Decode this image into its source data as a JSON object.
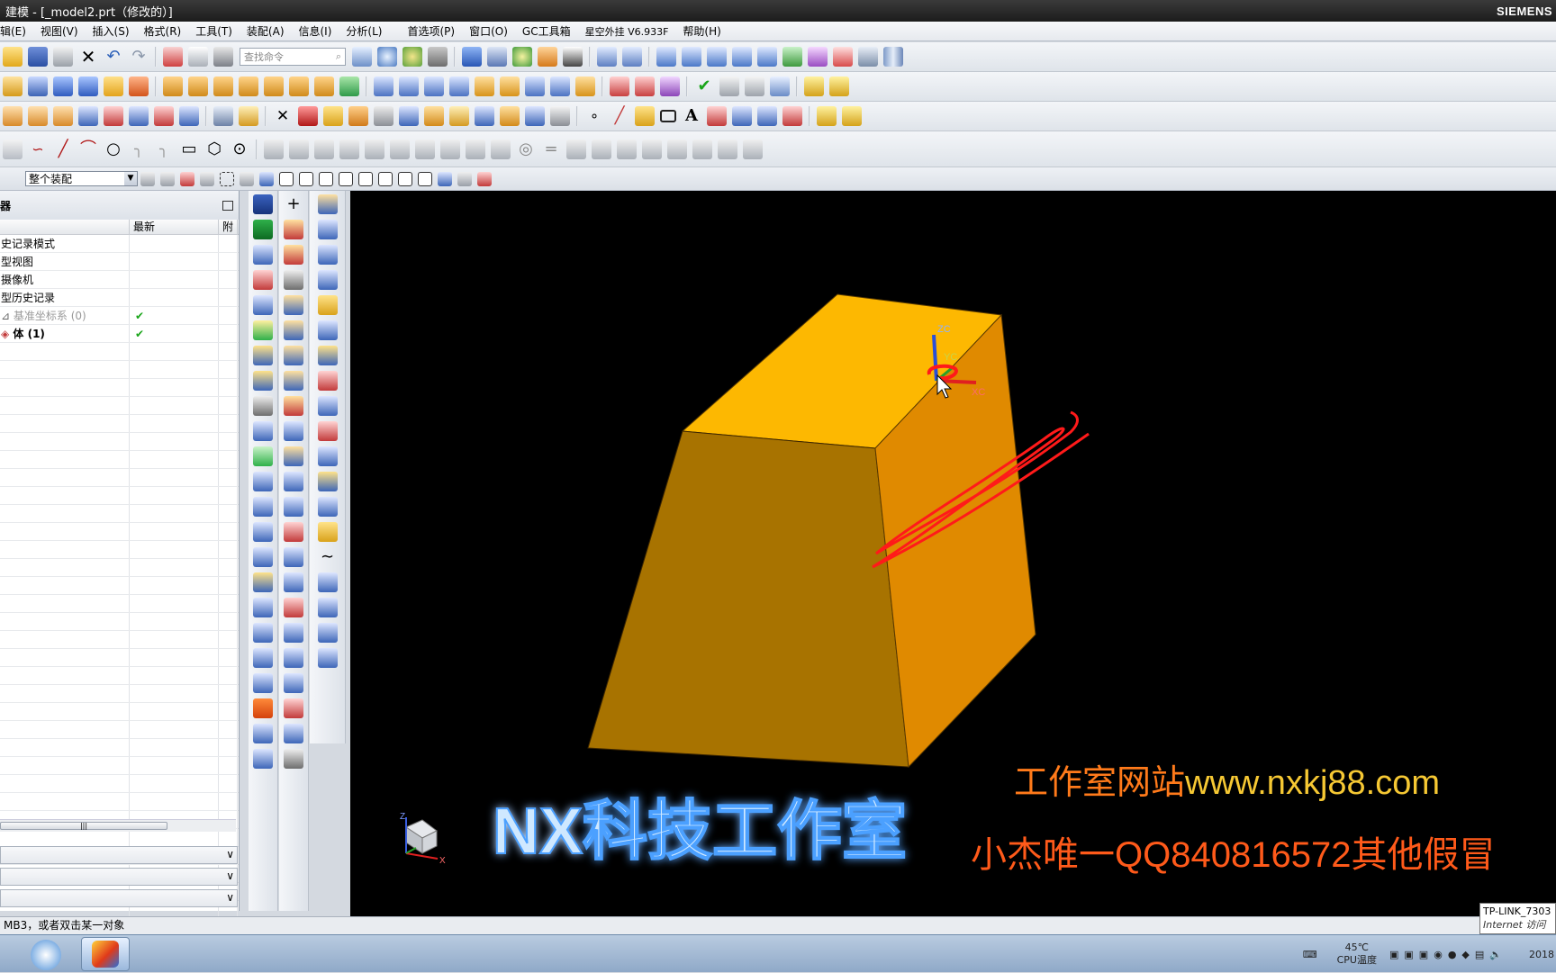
{
  "window": {
    "title": "建模 - [_model2.prt（修改的）]",
    "brand": "SIEMENS"
  },
  "menu": [
    "辑(E)",
    "视图(V)",
    "插入(S)",
    "格式(R)",
    "工具(T)",
    "装配(A)",
    "信息(I)",
    "分析(L)",
    "首选项(P)",
    "窗口(O)",
    "GC工具箱",
    "星空外挂 V6.933F",
    "帮助(H)"
  ],
  "toolbar": {
    "search_placeholder": "查找命令"
  },
  "selection": {
    "filter_value": "整个装配"
  },
  "navigator": {
    "title": "器",
    "columns": [
      "",
      "最新",
      "附"
    ],
    "rows": [
      {
        "label": "史记录模式",
        "latest": "",
        "dim": false
      },
      {
        "label": "型视图",
        "latest": "",
        "dim": false
      },
      {
        "label": "摄像机",
        "latest": "",
        "dim": false
      },
      {
        "label": "型历史记录",
        "latest": "",
        "dim": false
      },
      {
        "label": "基准坐标系 (0)",
        "latest": "✔",
        "dim": true
      },
      {
        "label": "体 (1)",
        "latest": "✔",
        "dim": false
      }
    ]
  },
  "viewport": {
    "axes": {
      "zc": "ZC",
      "yc": "YC",
      "xc": "XC"
    },
    "triad": {
      "z": "Z",
      "x": "X"
    },
    "watermark_main": "NX科技工作室",
    "watermark_site_prefix": "工作室网站",
    "watermark_site_url": "www.nxkj88.com",
    "watermark_qq": "小杰唯一QQ840816572其他假冒",
    "block_top_color": "#FDB801",
    "block_front_color": "#A87300",
    "block_right_color": "#E08A00"
  },
  "status": {
    "text": "MB3，或者双击某一对象"
  },
  "taskbar": {
    "temp": "45℃",
    "temp_label": "CPU温度",
    "year": "2018"
  },
  "tooltip": {
    "network": "TP-LINK_7303",
    "access": "Internet 访问"
  }
}
